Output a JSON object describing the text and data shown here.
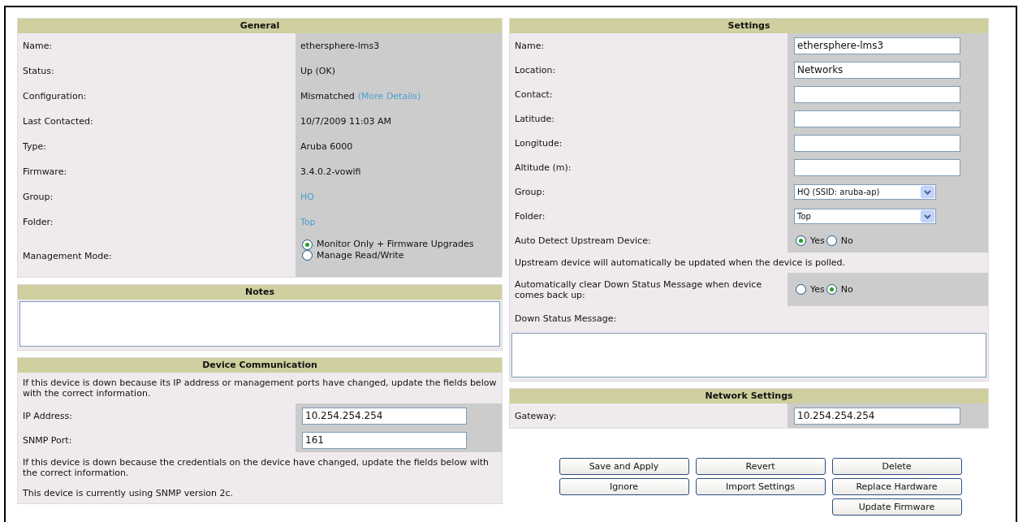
{
  "general": {
    "title": "General",
    "rows": [
      {
        "label": "Name:",
        "kind": "text",
        "value": "ethersphere-lms3"
      },
      {
        "label": "Status:",
        "kind": "text",
        "value": "Up (OK)"
      },
      {
        "label": "Configuration:",
        "kind": "text_link",
        "value": "Mismatched",
        "link": "(More Details)"
      },
      {
        "label": "Last Contacted:",
        "kind": "text",
        "value": "10/7/2009 11:03 AM"
      },
      {
        "label": "Type:",
        "kind": "text",
        "value": "Aruba 6000"
      },
      {
        "label": "Firmware:",
        "kind": "text",
        "value": "3.4.0.2-vowifi"
      },
      {
        "label": "Group:",
        "kind": "link",
        "value": "HQ"
      },
      {
        "label": "Folder:",
        "kind": "link",
        "value": "Top"
      },
      {
        "label": "Management Mode:",
        "kind": "radio",
        "options": [
          {
            "label": "Monitor Only + Firmware Upgrades",
            "selected": true
          },
          {
            "label": "Manage Read/Write",
            "selected": false
          }
        ]
      }
    ]
  },
  "notes": {
    "title": "Notes"
  },
  "device_communication": {
    "title": "Device Communication",
    "rows": [
      {
        "kind": "note",
        "text": "If this device is down because its IP address or management ports have changed, update the fields below with the correct information."
      },
      {
        "kind": "input",
        "label": "IP Address:",
        "value": "10.254.254.254"
      },
      {
        "kind": "input",
        "label": "SNMP Port:",
        "value": "161"
      },
      {
        "kind": "note",
        "text": "If this device is down because the credentials on the device have changed, update the fields below with the correct information."
      },
      {
        "kind": "note",
        "text": "This device is currently using SNMP version 2c."
      }
    ]
  },
  "settings": {
    "title": "Settings",
    "rows": [
      {
        "kind": "input",
        "label": "Name:",
        "value": "ethersphere-lms3"
      },
      {
        "kind": "input",
        "label": "Location:",
        "value": "Networks"
      },
      {
        "kind": "input",
        "label": "Contact:"
      },
      {
        "kind": "input",
        "label": "Latitude:"
      },
      {
        "kind": "input",
        "label": "Longitude:"
      },
      {
        "kind": "input",
        "label": "Altitude (m):"
      },
      {
        "kind": "select",
        "label": "Group:",
        "value": "HQ (SSID: aruba-ap)"
      },
      {
        "kind": "select",
        "label": "Folder:",
        "value": "Top"
      },
      {
        "kind": "radio",
        "label": "Auto Detect Upstream Device:",
        "options": [
          {
            "label": "Yes",
            "selected": true
          },
          {
            "label": "No",
            "selected": false
          }
        ]
      },
      {
        "kind": "note",
        "text": "Upstream device will automatically be updated when the device is polled."
      },
      {
        "kind": "radio",
        "label": "Automatically clear Down Status Message when device comes back up:",
        "options": [
          {
            "label": "Yes",
            "selected": false
          },
          {
            "label": "No",
            "selected": true
          }
        ]
      },
      {
        "kind": "label",
        "text": "Down Status Message:"
      },
      {
        "kind": "textarea"
      }
    ]
  },
  "network_settings": {
    "title": "Network Settings",
    "rows": [
      {
        "kind": "input",
        "label": "Gateway:",
        "value": "10.254.254.254"
      }
    ]
  },
  "button_columns": [
    [
      "Save and Apply",
      "Ignore"
    ],
    [
      "Revert",
      "Import Settings"
    ],
    [
      "Delete",
      "Replace Hardware",
      "Update Firmware"
    ]
  ]
}
